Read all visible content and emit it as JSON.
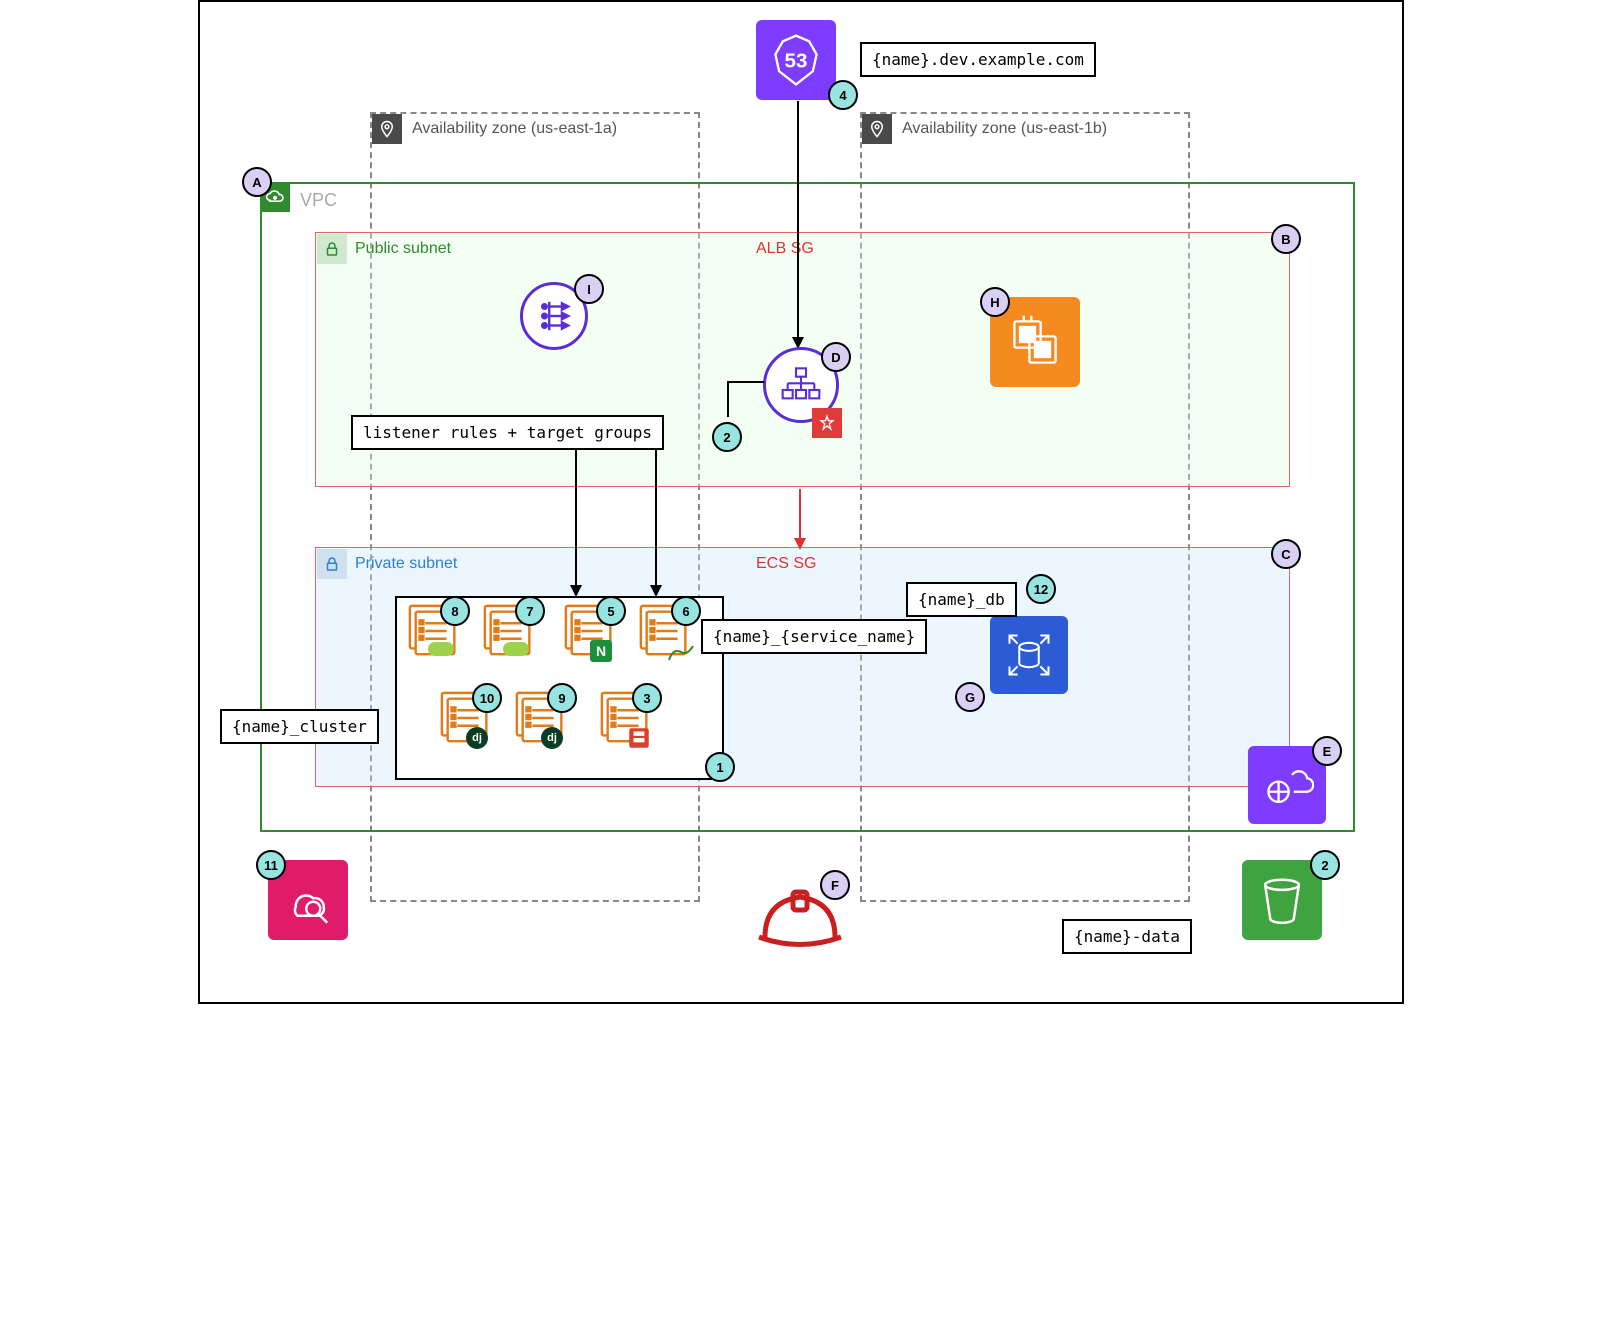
{
  "region": {
    "az_a": "Availability zone (us-east-1a)",
    "az_b": "Availability zone (us-east-1b)"
  },
  "vpc": {
    "label": "VPC"
  },
  "subnets": {
    "public_label": "Public subnet",
    "alb_sg": "ALB SG",
    "private_label": "Private subnet",
    "ecs_sg": "ECS SG"
  },
  "route53": {
    "domain": "{name}.dev.example.com",
    "badge": "4",
    "number": "53"
  },
  "alb": {
    "rules_label": "listener rules + target groups",
    "rules_badge": "2",
    "letter": "D"
  },
  "badges": {
    "A": "A",
    "B": "B",
    "C": "C",
    "D": "D",
    "E": "E",
    "F": "F",
    "G": "G",
    "H": "H",
    "I": "I"
  },
  "numbers": {
    "n1": "1",
    "n2": "2",
    "n3": "3",
    "n4": "4",
    "n5": "5",
    "n6": "6",
    "n7": "7",
    "n8": "8",
    "n9": "9",
    "n10": "10",
    "n11": "11",
    "n12": "12"
  },
  "cluster": {
    "label": "{name}_cluster",
    "service_label": "{name}_{service_name}",
    "cluster_badge": "1"
  },
  "db": {
    "label": "{name}_db"
  },
  "s3": {
    "label": "{name}-data",
    "badge": "2"
  },
  "cloudwatch_badge": "11"
}
